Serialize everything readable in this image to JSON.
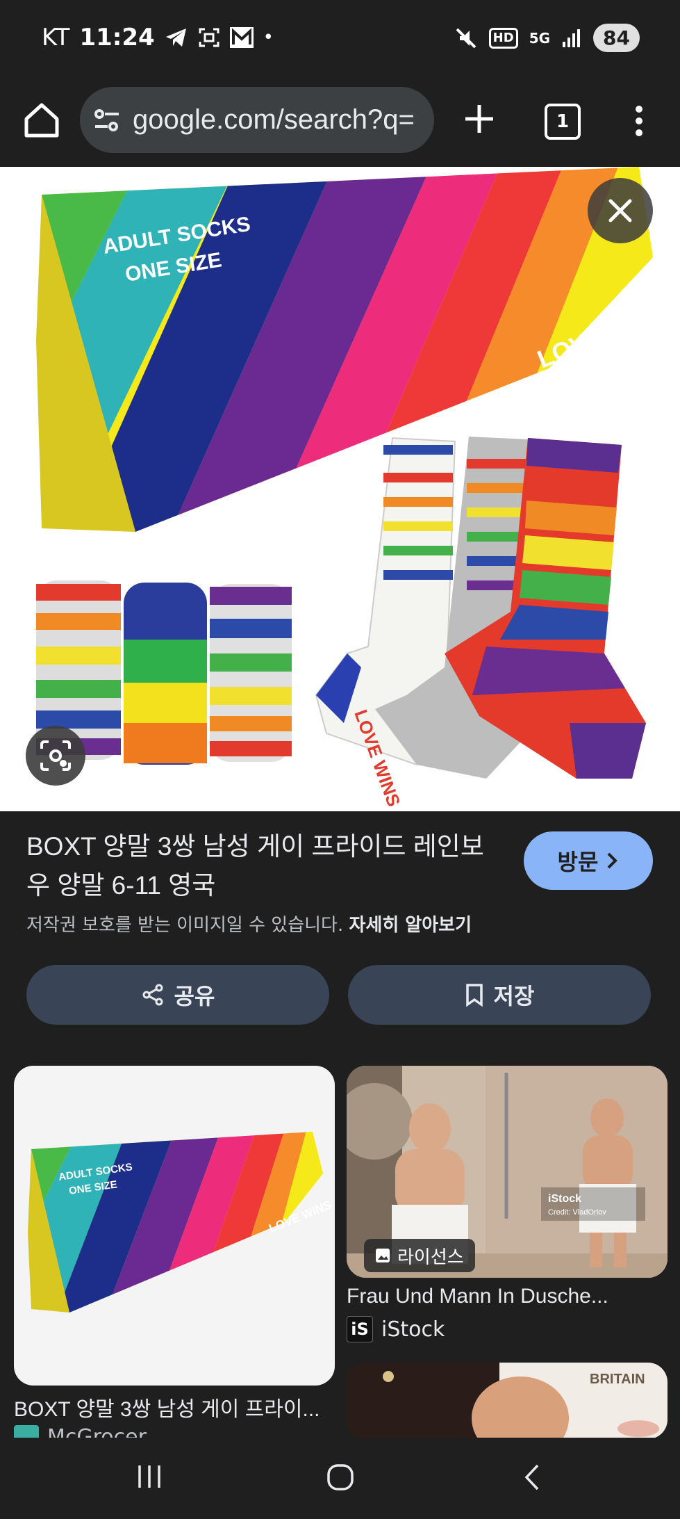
{
  "status_bar": {
    "carrier": "KT",
    "time": "11:24",
    "network": "5G",
    "hd_label": "HD",
    "battery": "84"
  },
  "browser": {
    "url": "google.com/search?q=",
    "tab_count": "1"
  },
  "hero_image": {
    "box_text_line1": "ADULT SOCKS",
    "box_text_line2": "ONE SIZE",
    "box_slogan": "LOVE WINS",
    "sock_text": "LOVE WINS"
  },
  "result": {
    "title": "BOXT 양말 3쌍 남성 게이 프라이드 레인보우 양말 6-11 영국",
    "visit_label": "방문",
    "copyright_text": "저작권 보호를 받는 이미지일 수 있습니다.",
    "learn_more": "자세히 알아보기",
    "share_label": "공유",
    "save_label": "저장"
  },
  "related": [
    {
      "title": "BOXT 양말 3쌍 남성 게이 프라이...",
      "source": "McGrocer",
      "box_text_line1": "ADULT SOCKS",
      "box_text_line2": "ONE SIZE",
      "box_slogan": "LOVE WINS"
    },
    {
      "title": "Frau Und Mann In Dusche...",
      "source": "iStock",
      "source_logo": "iS",
      "license_label": "라이선스",
      "watermark": "iStock",
      "watermark_credit": "Credit: VladOrlov"
    },
    {
      "watermark": "BRITAIN"
    }
  ],
  "colors": {
    "background": "#1f1f1f",
    "accent_button": "#8ab4f8",
    "action_button": "#394457",
    "omnibox": "#3c4043"
  },
  "icons": [
    "home-icon",
    "tune-icon",
    "plus-icon",
    "tabs-icon",
    "more-vert-icon",
    "close-icon",
    "lens-icon",
    "chevron-right-icon",
    "share-icon",
    "bookmark-icon",
    "image-icon",
    "recents-icon",
    "home-nav-icon",
    "back-icon"
  ]
}
